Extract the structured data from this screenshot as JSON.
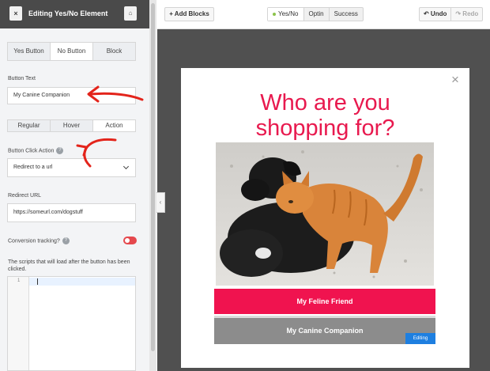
{
  "sidebar": {
    "title": "Editing Yes/No Element",
    "close_icon": "×",
    "home_icon": "⌂",
    "button_tabs": [
      {
        "label": "Yes Button",
        "active": false
      },
      {
        "label": "No Button",
        "active": true
      },
      {
        "label": "Block",
        "active": false
      }
    ],
    "button_text_label": "Button Text",
    "button_text_value": "My Canine Companion",
    "state_tabs": [
      {
        "label": "Regular",
        "active": false
      },
      {
        "label": "Hover",
        "active": false
      },
      {
        "label": "Action",
        "active": true
      }
    ],
    "click_action_label": "Button Click Action",
    "click_action_value": "Redirect to a url",
    "redirect_label": "Redirect URL",
    "redirect_value": "https://someurl.com/dogstuff",
    "conversion_label": "Conversion tracking?",
    "conversion_enabled": true,
    "scripts_desc": "The scripts that will load after the button has been clicked.",
    "editor_line": "1",
    "help_icon": "?"
  },
  "toolbar": {
    "add_blocks": "+ Add Blocks",
    "views": [
      {
        "label": "Yes/No",
        "active": true
      },
      {
        "label": "Optin",
        "active": false
      },
      {
        "label": "Success",
        "active": false
      }
    ],
    "undo": "↶ Undo",
    "redo": "↷ Redo"
  },
  "popup": {
    "close": "×",
    "title_line1": "Who are you",
    "title_line2": "shopping for?",
    "image_alt": "dog-and-cat-photo",
    "yes_button": "My Feline Friend",
    "no_button": "My Canine Companion",
    "editing_badge": "Editing"
  },
  "colors": {
    "title": "#e8194e",
    "yes_button_bg": "#f0134f",
    "no_button_bg": "#8c8c8c",
    "annotation_arrow": "#e3241b",
    "editing_badge": "#1e7fe0",
    "toggle": "#e5484d"
  }
}
